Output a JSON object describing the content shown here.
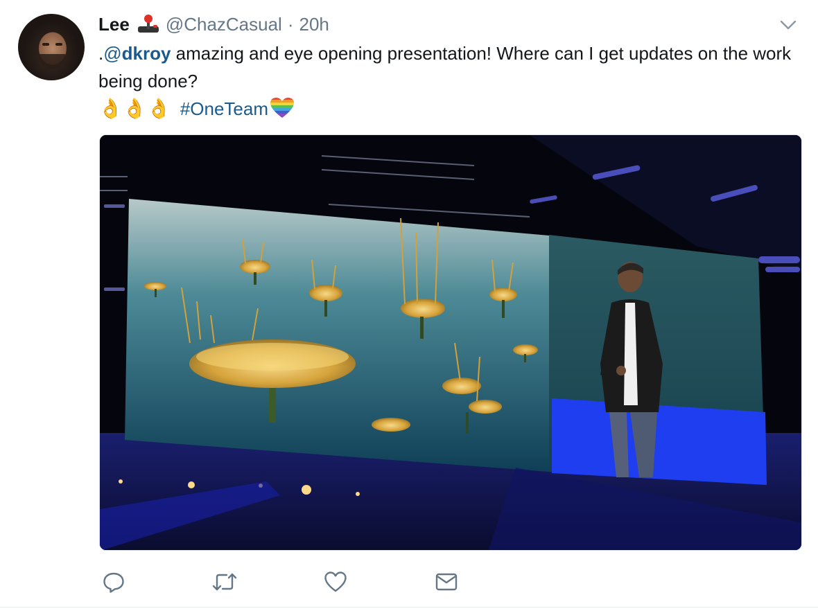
{
  "tweet": {
    "display_name": "Lee",
    "handle": "@ChazCasual",
    "separator": "·",
    "timestamp": "20h",
    "text": {
      "prefix": ".",
      "mention_at": "@",
      "mention_name": "dkroy",
      "body_1": " amazing and eye opening presentation! Where can I get updates on the work being done?",
      "emoji_line": "👌👌👌",
      "hashtag": "#OneTeam"
    }
  },
  "icons": {
    "name_emoji": "joystick-icon",
    "menu": "chevron-down-icon",
    "reply": "reply-icon",
    "retweet": "retweet-icon",
    "like": "heart-icon",
    "dm": "envelope-icon",
    "hashtag_emoji": "rainbow-heart-icon"
  },
  "colors": {
    "link": "#1b5a8c",
    "secondary_text": "#657786",
    "action_icon": "#657786"
  }
}
